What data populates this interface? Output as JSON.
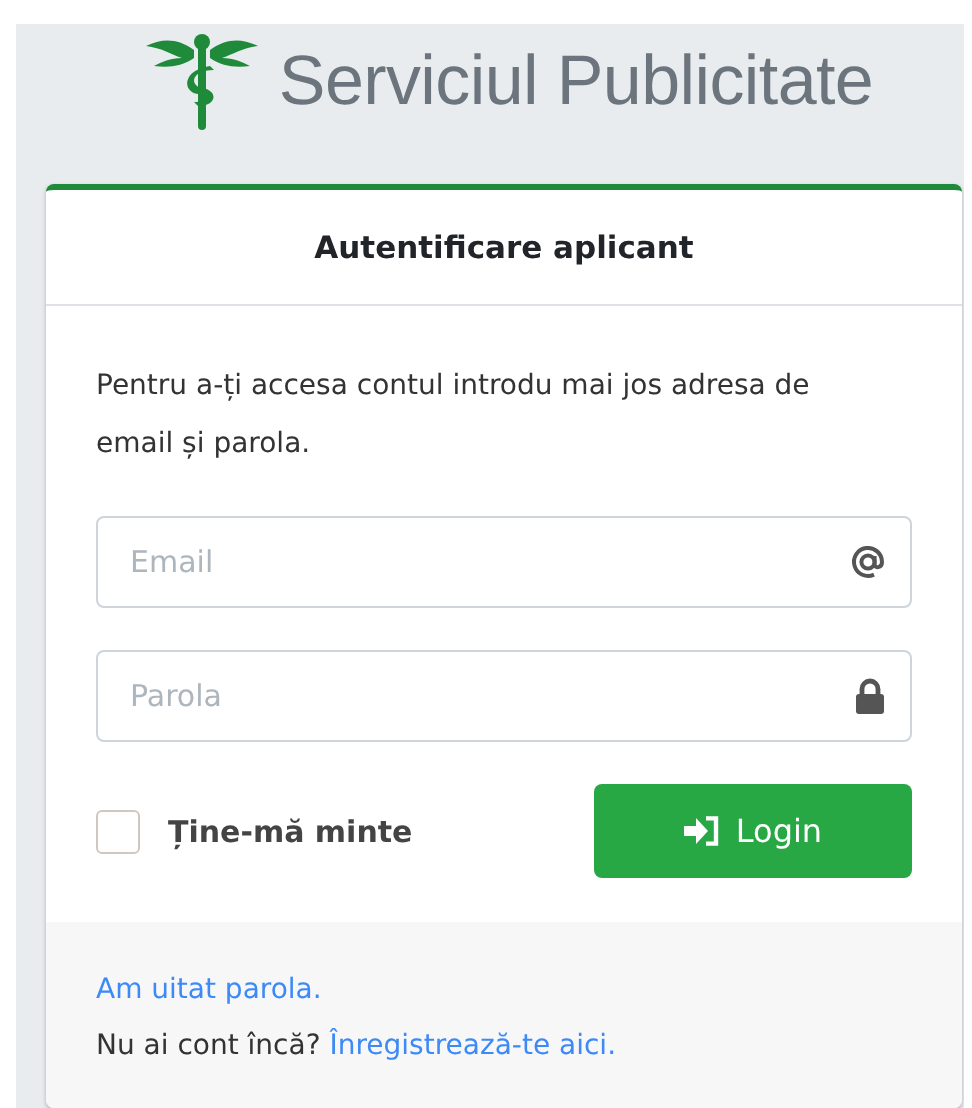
{
  "brand": {
    "title": "Serviciul Publicitate"
  },
  "card": {
    "title": "Autentificare aplicant",
    "intro": "Pentru a-ți accesa contul introdu mai jos adresa de email și parola.",
    "fields": [
      {
        "kind": "email",
        "placeholder": "Email"
      },
      {
        "kind": "password",
        "placeholder": "Parola"
      }
    ],
    "remember": {
      "label": "Ține-mă minte",
      "checked": false
    },
    "login_button": "Login",
    "forgot_link": "Am uitat parola.",
    "signup_prompt": "Nu ai cont încă?",
    "signup_link": "Înregistrează-te aici."
  }
}
